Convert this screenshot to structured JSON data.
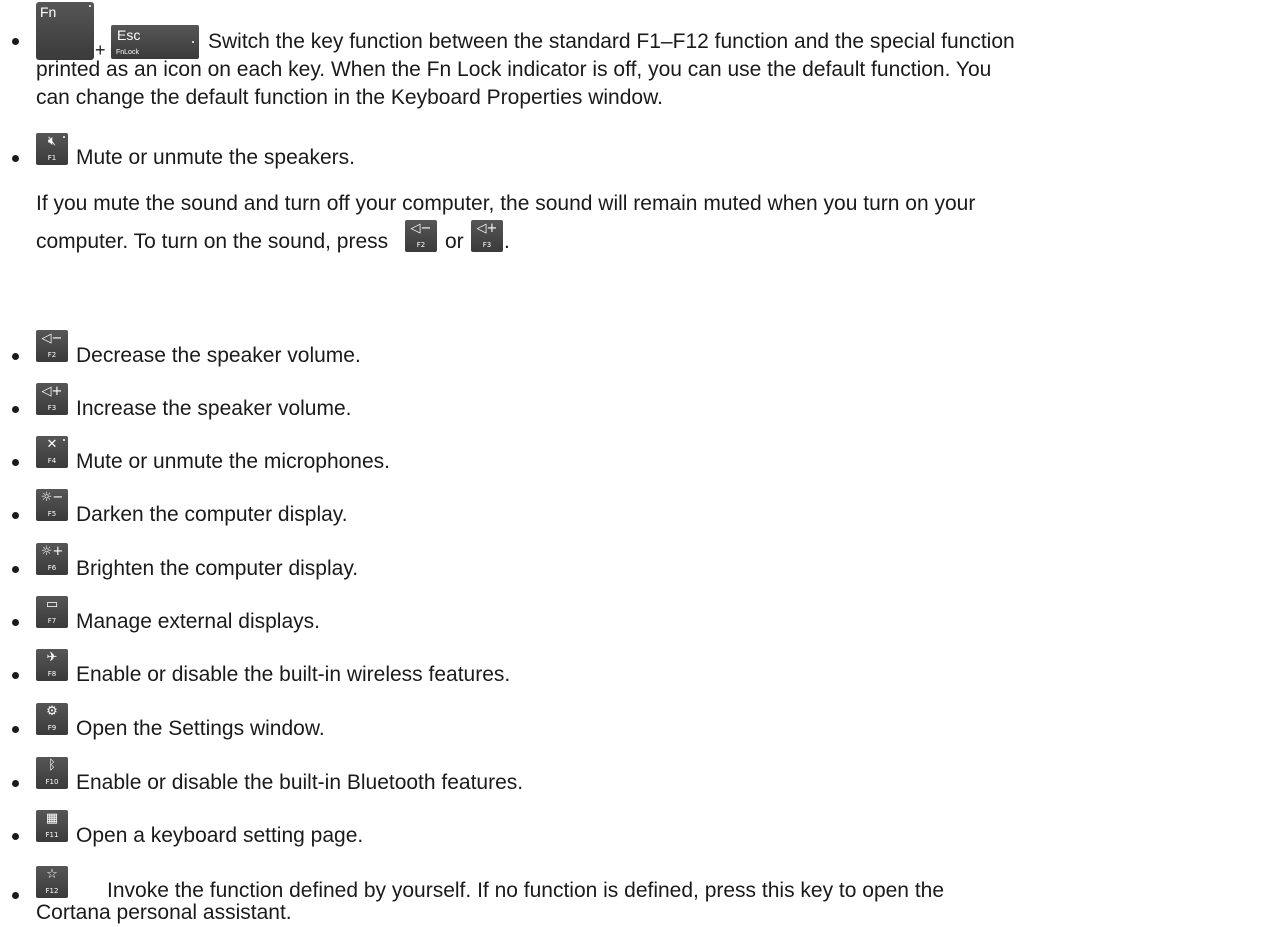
{
  "items": [
    {
      "combo": {
        "fn_label": "Fn",
        "plus": "+",
        "esc_label": "Esc",
        "fnlock_label": "FnLock"
      },
      "lines": [
        "Switch the key function between the standard F1–F12 function and the special function",
        "printed as an icon on each key. When the Fn Lock indicator is off, you can use the default function. You",
        "can change the default function in the Keyboard Properties window."
      ]
    },
    {
      "key": {
        "label": "F1",
        "icon": "speaker-mute-icon",
        "glyph": "🔇︎"
      },
      "text": "Mute or unmute the speakers.",
      "note": {
        "line1": "If you mute the sound and turn off your computer, the sound will remain muted when you turn on your",
        "line2_start": "computer. To turn on the sound, press",
        "or": "or",
        "end": ".",
        "key_a": {
          "label": "F2",
          "glyph": "◁−"
        },
        "key_b": {
          "label": "F3",
          "glyph": "◁+"
        }
      }
    },
    {
      "key": {
        "label": "F2",
        "icon": "volume-down-icon",
        "glyph": "◁−"
      },
      "text": "Decrease the speaker volume."
    },
    {
      "key": {
        "label": "F3",
        "icon": "volume-up-icon",
        "glyph": "◁+"
      },
      "text": "Increase the speaker volume."
    },
    {
      "key": {
        "label": "F4",
        "icon": "mic-mute-icon",
        "glyph": "✕"
      },
      "text": "Mute or unmute the microphones."
    },
    {
      "key": {
        "label": "F5",
        "icon": "brightness-down-icon",
        "glyph": "☼−"
      },
      "text": "Darken the computer display."
    },
    {
      "key": {
        "label": "F6",
        "icon": "brightness-up-icon",
        "glyph": "☼+"
      },
      "text": "Brighten the computer display."
    },
    {
      "key": {
        "label": "F7",
        "icon": "external-display-icon",
        "glyph": "▭"
      },
      "text": "Manage external displays."
    },
    {
      "key": {
        "label": "F8",
        "icon": "wireless-off-icon",
        "glyph": "✈"
      },
      "text": "Enable or disable the built-in wireless features."
    },
    {
      "key": {
        "label": "F9",
        "icon": "settings-gear-icon",
        "glyph": "⚙"
      },
      "text": "Open the Settings window."
    },
    {
      "key": {
        "label": "F10",
        "icon": "bluetooth-icon",
        "glyph": "ᛒ"
      },
      "text": "Enable or disable the built-in Bluetooth features."
    },
    {
      "key": {
        "label": "F11",
        "icon": "keyboard-icon",
        "glyph": "▦"
      },
      "text": "Open a keyboard setting page."
    },
    {
      "key": {
        "label": "F12",
        "icon": "star-icon",
        "glyph": "☆"
      },
      "lines": [
        "Invoke the function defined by yourself. If no function is defined, press this key to open the",
        "Cortana personal assistant."
      ]
    }
  ]
}
